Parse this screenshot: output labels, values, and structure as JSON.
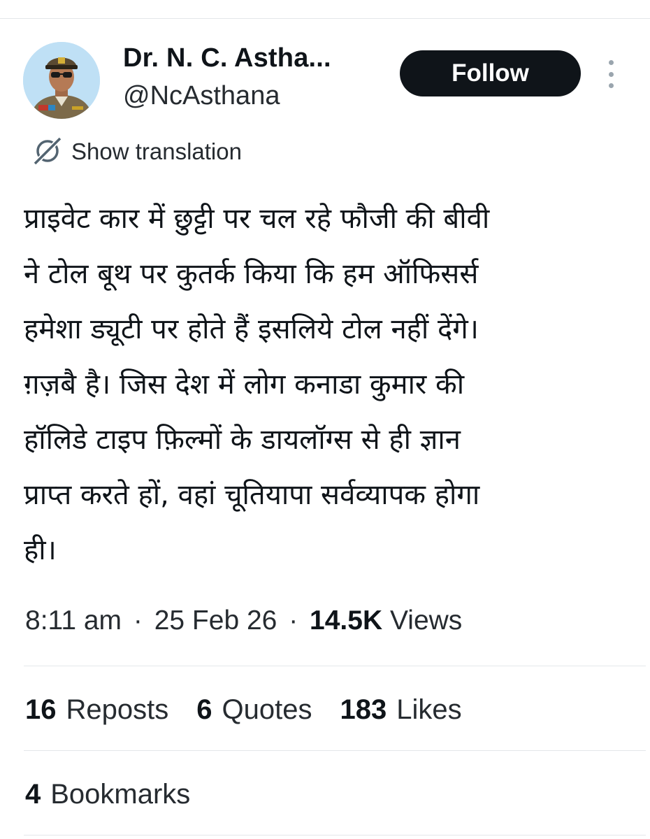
{
  "author": {
    "display_name": "Dr. N. C. Astha...",
    "handle": "@NcAsthana",
    "avatar_icon": "avatar-police-officer"
  },
  "follow_label": "Follow",
  "translation": {
    "label": "Show translation",
    "icon": "translate-icon"
  },
  "tweet": {
    "lines": [
      "प्राइवेट कार में छुट्टी पर चल रहे फौजी की बीवी",
      "ने टोल बूथ पर कुतर्क किया कि हम ऑफिसर्स",
      "हमेशा ड्यूटी पर होते हैं इसलिये टोल नहीं देंगे।",
      "ग़ज़बै है। जिस देश में लोग कनाडा कुमार की",
      "हॉलिडे टाइप फ़िल्मों के डायलॉग्स से ही ज्ञान",
      "प्राप्त करते हों, वहां चूतियापा सर्वव्यापक होगा",
      "ही।"
    ]
  },
  "meta": {
    "time": "8:11 am",
    "separator": "·",
    "date": "25 Feb 26",
    "views_count": "14.5K",
    "views_label": "Views"
  },
  "stats": {
    "reposts": {
      "count": "16",
      "label": "Reposts"
    },
    "quotes": {
      "count": "6",
      "label": "Quotes"
    },
    "likes": {
      "count": "183",
      "label": "Likes"
    },
    "bookmarks": {
      "count": "4",
      "label": "Bookmarks"
    }
  },
  "colors": {
    "text": "#0f1419",
    "secondary": "#262b30",
    "follow_bg": "#0f1419",
    "divider": "#e4e7ea"
  }
}
